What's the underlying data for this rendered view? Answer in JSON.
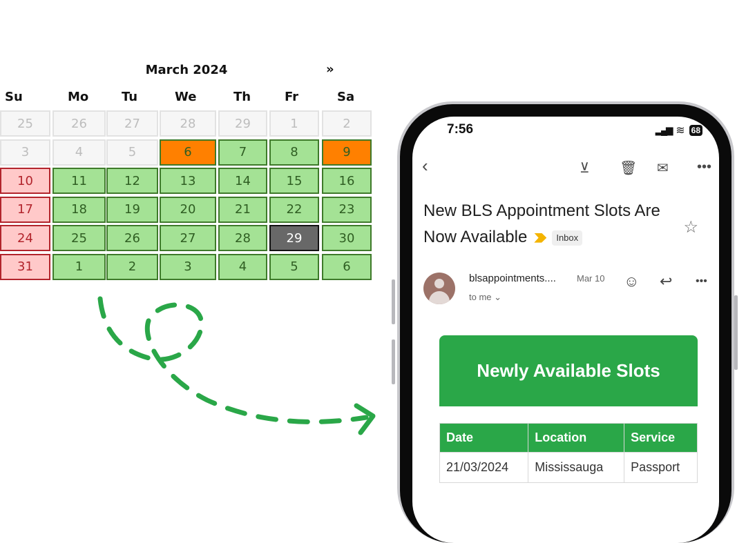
{
  "calendar": {
    "title": "March 2024",
    "next_label": "»",
    "weekdays": [
      "Su",
      "Mo",
      "Tu",
      "We",
      "Th",
      "Fr",
      "Sa"
    ],
    "weeks": [
      [
        {
          "d": "25",
          "s": "off"
        },
        {
          "d": "26",
          "s": "off"
        },
        {
          "d": "27",
          "s": "off"
        },
        {
          "d": "28",
          "s": "off"
        },
        {
          "d": "29",
          "s": "off"
        },
        {
          "d": "1",
          "s": "off"
        },
        {
          "d": "2",
          "s": "off"
        }
      ],
      [
        {
          "d": "3",
          "s": "off"
        },
        {
          "d": "4",
          "s": "off"
        },
        {
          "d": "5",
          "s": "off"
        },
        {
          "d": "6",
          "s": "orange"
        },
        {
          "d": "7",
          "s": "avail"
        },
        {
          "d": "8",
          "s": "avail"
        },
        {
          "d": "9",
          "s": "orange"
        }
      ],
      [
        {
          "d": "10",
          "s": "red"
        },
        {
          "d": "11",
          "s": "avail"
        },
        {
          "d": "12",
          "s": "avail"
        },
        {
          "d": "13",
          "s": "avail"
        },
        {
          "d": "14",
          "s": "avail"
        },
        {
          "d": "15",
          "s": "avail"
        },
        {
          "d": "16",
          "s": "avail"
        }
      ],
      [
        {
          "d": "17",
          "s": "red"
        },
        {
          "d": "18",
          "s": "avail"
        },
        {
          "d": "19",
          "s": "avail"
        },
        {
          "d": "20",
          "s": "avail"
        },
        {
          "d": "21",
          "s": "avail"
        },
        {
          "d": "22",
          "s": "avail"
        },
        {
          "d": "23",
          "s": "avail"
        }
      ],
      [
        {
          "d": "24",
          "s": "red"
        },
        {
          "d": "25",
          "s": "avail"
        },
        {
          "d": "26",
          "s": "avail"
        },
        {
          "d": "27",
          "s": "avail"
        },
        {
          "d": "28",
          "s": "avail"
        },
        {
          "d": "29",
          "s": "sel"
        },
        {
          "d": "30",
          "s": "avail"
        }
      ],
      [
        {
          "d": "31",
          "s": "red"
        },
        {
          "d": "1",
          "s": "avail"
        },
        {
          "d": "2",
          "s": "avail"
        },
        {
          "d": "3",
          "s": "avail"
        },
        {
          "d": "4",
          "s": "avail"
        },
        {
          "d": "5",
          "s": "avail"
        },
        {
          "d": "6",
          "s": "avail"
        }
      ]
    ]
  },
  "arrow": {
    "color": "#2aa748"
  },
  "phone": {
    "status": {
      "time": "7:56",
      "battery": "68"
    },
    "email": {
      "subject": "New BLS Appointment Slots Are Now Available",
      "label": "Inbox",
      "sender": "blsappointments....",
      "date": "Mar 10",
      "recipient": "to me ⌄",
      "banner": "Newly Available Slots",
      "table": {
        "headers": [
          "Date",
          "Location",
          "Service"
        ],
        "rows": [
          [
            "21/03/2024",
            "Mississauga",
            "Passport"
          ]
        ]
      }
    }
  },
  "colors": {
    "accent_green": "#2aa748",
    "available": "#a4e295",
    "booked_orange": "#ff8000",
    "closed_red": "#ffc9c9",
    "selected": "#686868"
  }
}
